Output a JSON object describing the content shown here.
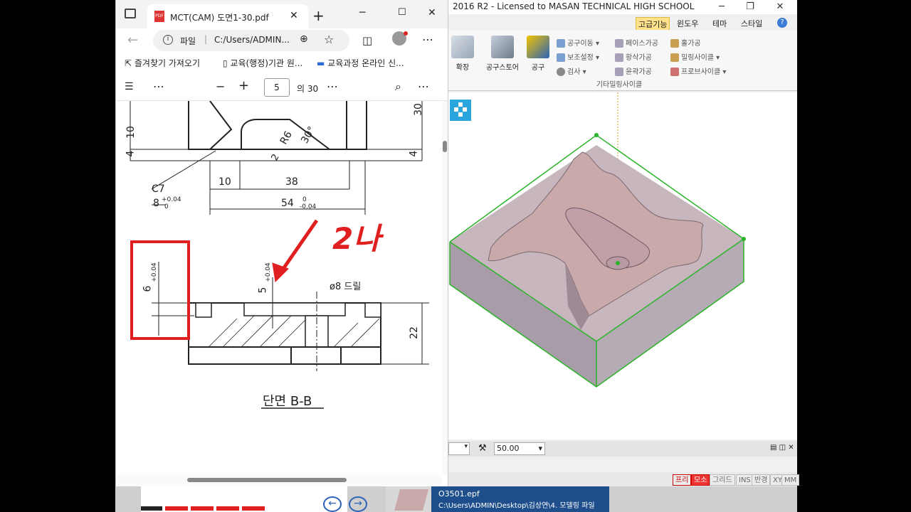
{
  "cam": {
    "title": "2016 R2  - Licensed to MASAN TECHNICAL HIGH SCHOOL",
    "menu": [
      "고급기능",
      "윈도우",
      "테마",
      "스타일"
    ],
    "ribbon": {
      "big_buttons": [
        "확장",
        "공구스토어",
        "공구"
      ],
      "small_items": [
        "공구이동",
        "보조설정",
        "검사",
        "페이스가공",
        "황삭가공",
        "윤곽가공",
        "홀가공",
        "밀링사이클",
        "프로브사이클"
      ],
      "group_label": "기타밀링사이클"
    },
    "bottom_value": "50.00",
    "status_items": [
      "프리",
      "모소",
      "그리드",
      "INS",
      "반경",
      "XY",
      "MM"
    ]
  },
  "pdf": {
    "tab_title": "MCT(CAM) 도면1-30.pdf",
    "address_label": "파일",
    "address": "C:/Users/ADMIN...",
    "favorites": [
      "즐겨찾기 가져오기",
      "교육(행정)기관 원...",
      "교육과정 온라인 신..."
    ],
    "page_number": "5",
    "page_total": "의 30",
    "drawing": {
      "dim_30": "30",
      "dim_10_left": "10",
      "dim_4_left": "4",
      "dim_4_right": "4",
      "r6": "R6",
      "angle": "30°",
      "two": "2",
      "c7": "C7",
      "dim_8": "8",
      "tol_8": "+0.04",
      "tol_8_b": "0",
      "dim_10": "10",
      "dim_38": "38",
      "dim_54": "54",
      "tol_54_a": "0",
      "tol_54_b": "-0.04",
      "dim_6": "6",
      "tol_6": "+0.04",
      "dim_5": "5",
      "tol_5": "+0.04",
      "drill": "ø8 드릴",
      "dim_22": "22",
      "section": "단면 B-B",
      "handwriting": "2나"
    }
  },
  "taskbar": {
    "filename": "O3501.epf",
    "path": "C:\\Users\\ADMIN\\Desktop\\김상연\\4. 모델링 파일"
  },
  "colors": {
    "accent_red": "#e02020",
    "model_face": "#c9a9a9",
    "model_side": "#a79ca8",
    "bbox_green": "#2ab42a",
    "menu_highlight": "#ffe28a"
  }
}
